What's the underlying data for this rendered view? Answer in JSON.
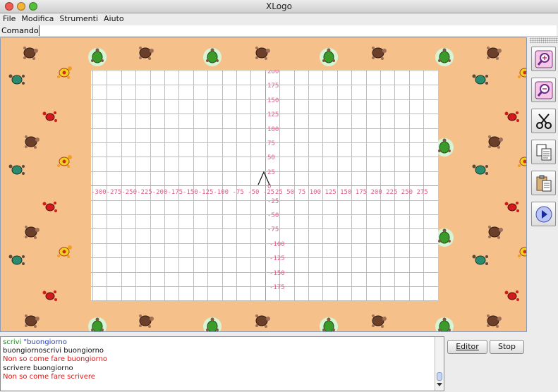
{
  "window": {
    "title": "XLogo"
  },
  "menu": [
    "File",
    "Modifica",
    "Strumenti",
    "Aiuto"
  ],
  "command": {
    "label": "Comando:",
    "value": ""
  },
  "axes": {
    "x_ticks": [
      "-300",
      "-275",
      "-250",
      "-225",
      "-200",
      "-175",
      "-150",
      "-125",
      "-100",
      "-75",
      "-50",
      "-25",
      "25",
      "50",
      "75",
      "100",
      "125",
      "150",
      "175",
      "200",
      "225",
      "250",
      "275"
    ],
    "y_ticks": [
      "200",
      "175",
      "150",
      "125",
      "100",
      "75",
      "50",
      "25",
      "0",
      "-25",
      "-50",
      "-75",
      "-100",
      "-125",
      "-150",
      "-175"
    ],
    "x_tick_text": "-300-275-250-225-200-175-150-125-100 -75 -50 -25",
    "x_tick_text_right": "25  50  75  100 125 150 175 200 225 250 275",
    "grid_color": "#bdbdbd",
    "tick_color": "#e05c8a",
    "background_color": "#f5c08a"
  },
  "toolbar": {
    "icons": [
      "zoom-in-icon",
      "zoom-out-icon",
      "scissors-icon",
      "copy-icon",
      "paste-icon",
      "play-icon"
    ]
  },
  "history": [
    {
      "parts": [
        {
          "text": "scrivi ",
          "color": "#1a8f1a"
        },
        {
          "text": "\"buongiorno",
          "color": "#1f3bd6"
        }
      ]
    },
    {
      "parts": [
        {
          "text": "buongiornoscrivi buongiorno",
          "color": "#111111"
        }
      ]
    },
    {
      "parts": [
        {
          "text": "Non so come fare buongiorno",
          "color": "#e01515"
        }
      ]
    },
    {
      "parts": [
        {
          "text": "scrivere buongiorno",
          "color": "#111111"
        }
      ]
    },
    {
      "parts": [
        {
          "text": "Non so come fare scrivere",
          "color": "#e01515"
        }
      ]
    }
  ],
  "buttons": {
    "editor": "Editor",
    "stop": "Stop"
  }
}
